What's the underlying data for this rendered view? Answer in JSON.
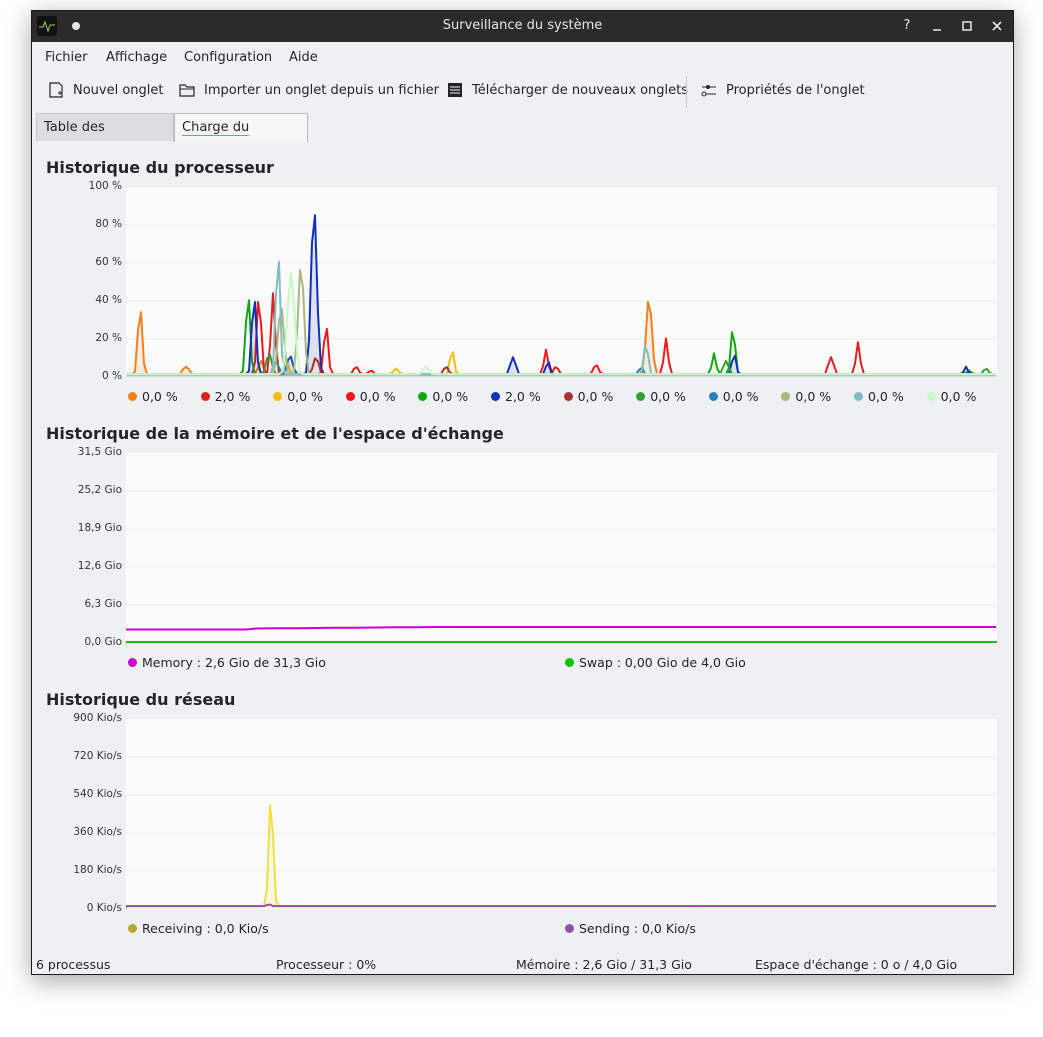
{
  "window": {
    "title": "Surveillance du système"
  },
  "menu": [
    "Fichier",
    "Affichage",
    "Configuration",
    "Aide"
  ],
  "toolbar": {
    "new_tab": "Nouvel onglet",
    "import_tab": "Importer un onglet depuis un fichier",
    "download_tabs": "Télécharger de nouveaux onglets",
    "tab_properties": "Propriétés de l'onglet"
  },
  "tabs": {
    "processes": "Table des processus",
    "system_load": "Charge du système"
  },
  "cpu": {
    "title": "Historique du processeur",
    "yticks": [
      "100 %",
      "80 %",
      "60 %",
      "40 %",
      "20 %",
      "0 %"
    ],
    "legend": [
      {
        "value": "0,0 %",
        "color": "#f48020"
      },
      {
        "value": "2,0 %",
        "color": "#e02020"
      },
      {
        "value": "0,0 %",
        "color": "#f0c000"
      },
      {
        "value": "0,0 %",
        "color": "#f01818"
      },
      {
        "value": "0,0 %",
        "color": "#10a810"
      },
      {
        "value": "2,0 %",
        "color": "#1030b8"
      },
      {
        "value": "0,0 %",
        "color": "#a83030"
      },
      {
        "value": "0,0 %",
        "color": "#30a030"
      },
      {
        "value": "0,0 %",
        "color": "#2a80b0"
      },
      {
        "value": "0,0 %",
        "color": "#a8b880"
      },
      {
        "value": "0,0 %",
        "color": "#80bcc0"
      },
      {
        "value": "0,0 %",
        "color": "#c8f8c8"
      }
    ]
  },
  "memory": {
    "title": "Historique de la mémoire et de l'espace d'échange",
    "yticks": [
      "31,5 Gio",
      "25,2 Gio",
      "18,9 Gio",
      "12,6 Gio",
      "6,3 Gio",
      "0,0 Gio"
    ],
    "legend": [
      {
        "label": "Memory : 2,6 Gio de 31,3 Gio",
        "color": "#d000d0"
      },
      {
        "label": "Swap : 0,00 Gio de 4,0 Gio",
        "color": "#10c010"
      }
    ]
  },
  "network": {
    "title": "Historique du réseau",
    "yticks": [
      "900 Kio/s",
      "720 Kio/s",
      "540 Kio/s",
      "360 Kio/s",
      "180 Kio/s",
      "0 Kio/s"
    ],
    "legend": [
      {
        "label": "Receiving : 0,0 Kio/s",
        "color": "#b8a830"
      },
      {
        "label": "Sending : 0,0 Kio/s",
        "color": "#9050b0"
      }
    ]
  },
  "status": {
    "processes": "6 processus",
    "cpu": "Processeur : 0%",
    "memory": "Mémoire : 2,6 Gio / 31,3 Gio",
    "swap": "Espace d'échange : 0 o / 4,0 Gio"
  }
}
